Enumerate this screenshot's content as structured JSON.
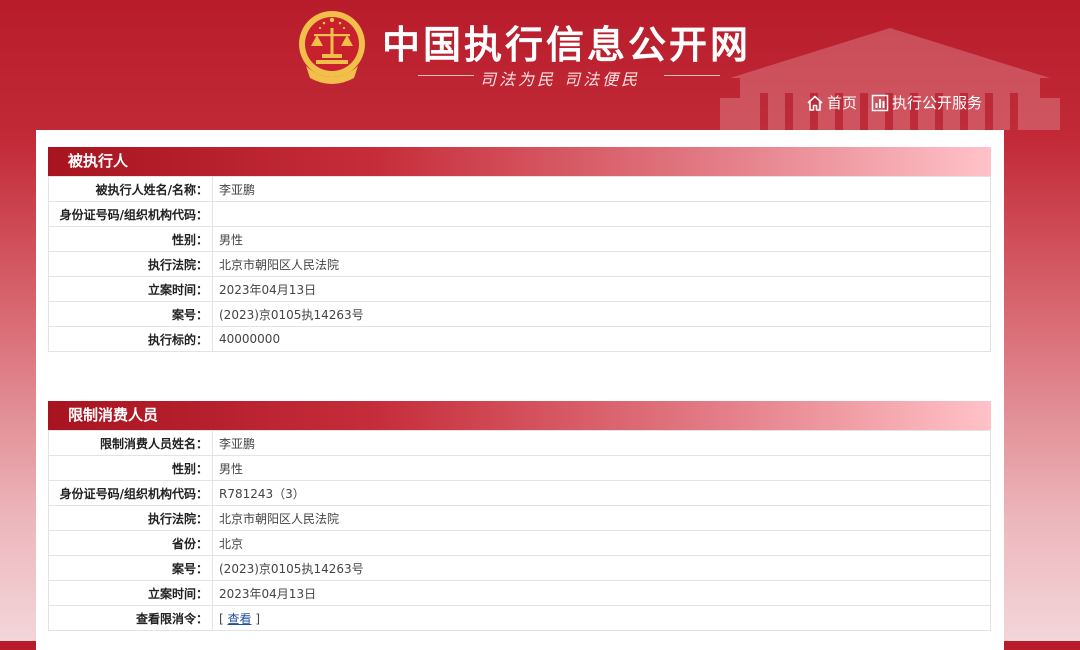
{
  "header": {
    "site_title": "中国执行信息公开网",
    "slogan": "司法为民   司法便民",
    "nav": [
      {
        "label": "首页",
        "icon": "home-icon"
      },
      {
        "label": "执行公开服务",
        "icon": "chart-icon"
      }
    ]
  },
  "colors": {
    "brand_red": "#b81c2b",
    "section_header_start": "#a7141f",
    "section_header_end": "#ffc2c8",
    "link": "#2050a0"
  },
  "sections": [
    {
      "title": "被执行人",
      "rows": [
        {
          "label": "被执行人姓名/名称：",
          "value": "李亚鹏"
        },
        {
          "label": "身份证号码/组织机构代码：",
          "value": ""
        },
        {
          "label": "性别：",
          "value": "男性"
        },
        {
          "label": "执行法院：",
          "value": "北京市朝阳区人民法院"
        },
        {
          "label": "立案时间：",
          "value": "2023年04月13日"
        },
        {
          "label": "案号：",
          "value": "(2023)京0105执14263号"
        },
        {
          "label": "执行标的：",
          "value": "40000000"
        }
      ]
    },
    {
      "title": "限制消费人员",
      "rows": [
        {
          "label": "限制消费人员姓名：",
          "value": "李亚鹏"
        },
        {
          "label": "性别：",
          "value": "男性"
        },
        {
          "label": "身份证号码/组织机构代码：",
          "value": "R781243（3）"
        },
        {
          "label": "执行法院：",
          "value": "北京市朝阳区人民法院"
        },
        {
          "label": "省份：",
          "value": "北京"
        },
        {
          "label": "案号：",
          "value": "(2023)京0105执14263号"
        },
        {
          "label": "立案时间：",
          "value": "2023年04月13日"
        },
        {
          "label": "查看限消令：",
          "value_prefix": "[ ",
          "link": "查看",
          "value_suffix": " ]"
        }
      ]
    }
  ]
}
